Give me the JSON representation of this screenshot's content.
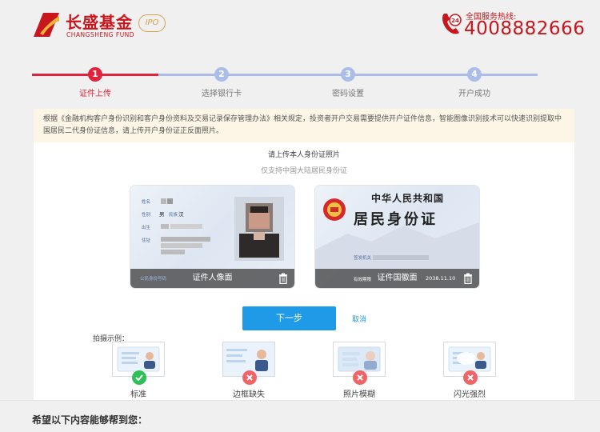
{
  "brand": {
    "name_cn": "长盛基金",
    "name_en": "CHANGSHENG FUND",
    "ipo_badge": "IPO"
  },
  "hotline": {
    "label": "全国服务热线:",
    "number": "4008882666",
    "badge": "24"
  },
  "steps": [
    {
      "num": "1",
      "label": "证件上传",
      "active": true
    },
    {
      "num": "2",
      "label": "选择银行卡",
      "active": false
    },
    {
      "num": "3",
      "label": "密码设置",
      "active": false
    },
    {
      "num": "4",
      "label": "开户成功",
      "active": false
    }
  ],
  "notice": "根据《金融机构客户身份识别和客户身份资料及交易记录保存管理办法》相关规定，投资者开户交易需要提供开户证件信息，智能图像识别技术可以快速识别提取中国居民二代身份证信息，请上传开户身份证正反面照片。",
  "upload": {
    "title": "请上传本人身份证照片",
    "subtitle": "仅支持中国大陆居民身份证"
  },
  "cards": {
    "front": {
      "label": "证件人像面",
      "fields": [
        "姓名",
        "性别",
        "民族",
        "出生",
        "住址",
        "公民身份号码"
      ],
      "gender": "男",
      "ethnicity": "汉"
    },
    "back": {
      "label": "证件国徽面",
      "country": "中华人民共和国",
      "title": "居民身份证",
      "authority_label": "签发机关",
      "validity_label": "有效期限",
      "validity_end": "2038.11.10"
    }
  },
  "actions": {
    "next": "下一步",
    "cancel": "取消"
  },
  "examples": {
    "title": "拍摄示例：",
    "items": [
      {
        "label": "标准",
        "status": "ok"
      },
      {
        "label": "边框缺失",
        "status": "bad"
      },
      {
        "label": "照片模糊",
        "status": "bad"
      },
      {
        "label": "闪光强烈",
        "status": "bad"
      }
    ]
  },
  "help": {
    "title": "希望以下内容能够帮到您："
  },
  "colors": {
    "brand_red": "#c8161d",
    "step_active": "#e0233c",
    "step_inactive": "#a9bde8",
    "primary_blue": "#1e9ae6",
    "ok_green": "#2fbf57",
    "bad_red": "#f06467"
  }
}
